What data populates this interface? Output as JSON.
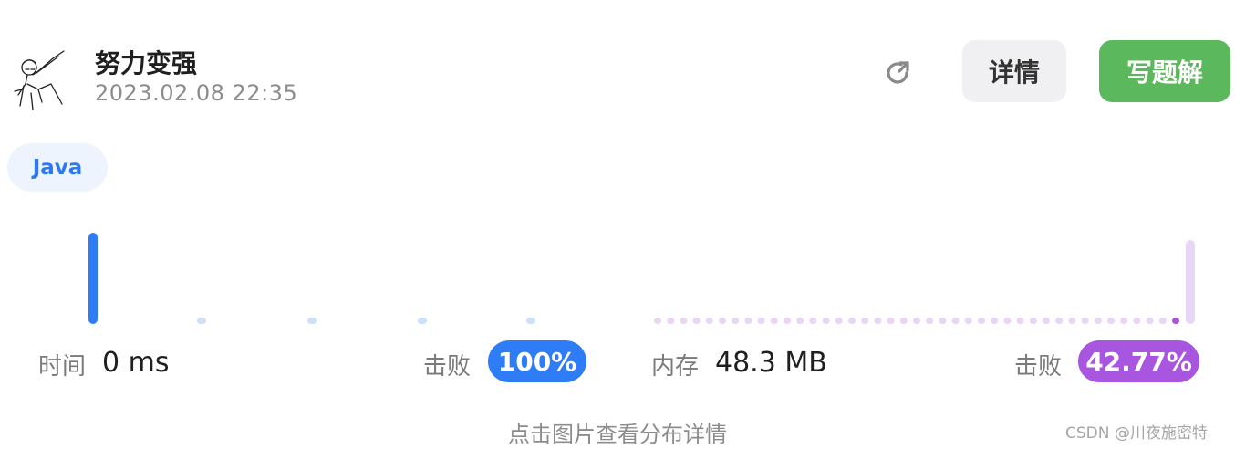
{
  "header": {
    "username": "努力变强",
    "timestamp": "2023.02.08 22:35",
    "details_button": "详情",
    "solution_button": "写题解"
  },
  "language_tag": "Java",
  "runtime": {
    "label": "时间",
    "value": "0 ms",
    "beat_label": "击败",
    "beat_percent": "100%",
    "highlighted_bucket": 0,
    "color": "#2e7df6",
    "faded_color": "#cfe0fb"
  },
  "memory": {
    "label": "内存",
    "value": "48.3 MB",
    "beat_label": "击败",
    "beat_percent": "42.77%",
    "color": "#a855e0",
    "faded_color": "#e8d6f5"
  },
  "hint": "点击图片查看分布详情",
  "watermark": "CSDN @川夜施密特",
  "icons": {
    "avatar": "sketch-avatar",
    "refresh": "refresh-icon"
  }
}
